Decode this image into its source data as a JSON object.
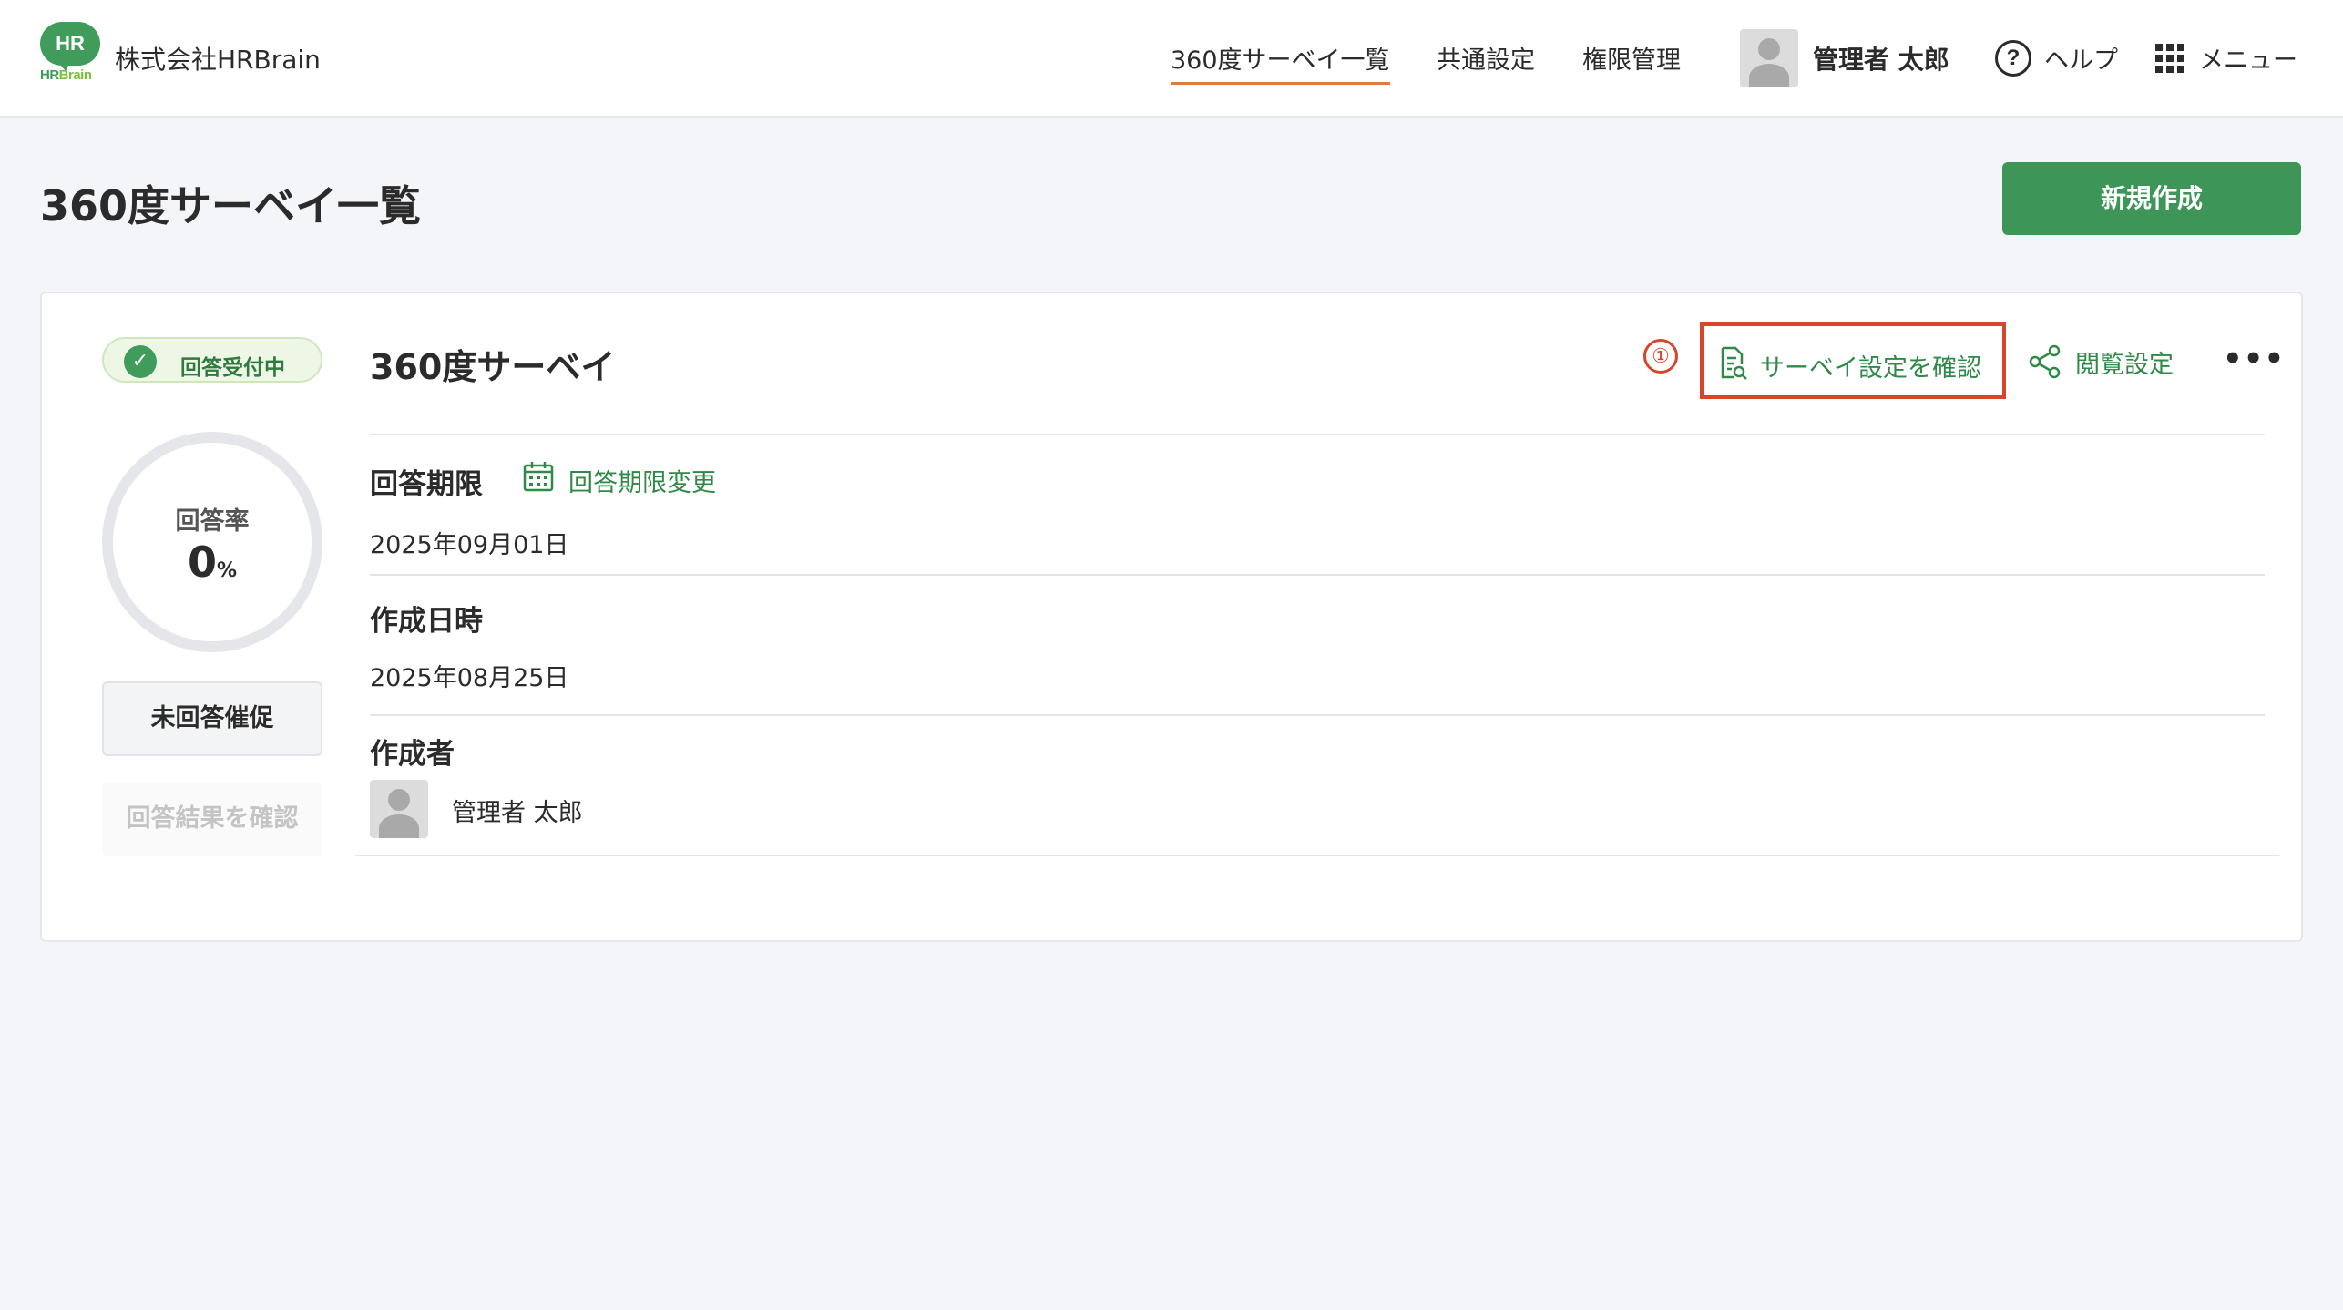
{
  "header": {
    "logo_text": "HR",
    "logo_sub_hr": "HR",
    "logo_sub_brain": "Brain",
    "company": "株式会社HRBrain",
    "nav": [
      {
        "label": "360度サーベイ一覧",
        "active": true
      },
      {
        "label": "共通設定",
        "active": false
      },
      {
        "label": "権限管理",
        "active": false
      }
    ],
    "user_name": "管理者 太郎",
    "help_label": "ヘルプ",
    "menu_label": "メニュー"
  },
  "page": {
    "title": "360度サーベイ一覧",
    "new_button": "新規作成"
  },
  "card": {
    "status": "回答受付中",
    "rate_label": "回答率",
    "rate_value": "0",
    "rate_unit": "%",
    "rate_fraction": 0,
    "remind_button": "未回答催促",
    "results_button": "回答結果を確認",
    "survey_title": "360度サーベイ",
    "step_marker": "①",
    "check_settings": "サーベイ設定を確認",
    "view_settings": "閲覧設定",
    "more": "•••",
    "deadline_label": "回答期限",
    "deadline_change": "回答期限変更",
    "deadline_value": "2025年09月01日",
    "created_label": "作成日時",
    "created_value": "2025年08月25日",
    "creator_label": "作成者",
    "creator_name": "管理者 太郎"
  },
  "colors": {
    "brand_green": "#3d9558",
    "accent_orange": "#e07b39",
    "highlight_red": "#d9452b"
  },
  "icons": [
    "help-icon",
    "menu-grid-icon",
    "check-icon",
    "document-search-icon",
    "share-icon",
    "more-icon",
    "calendar-icon",
    "avatar-icon"
  ]
}
